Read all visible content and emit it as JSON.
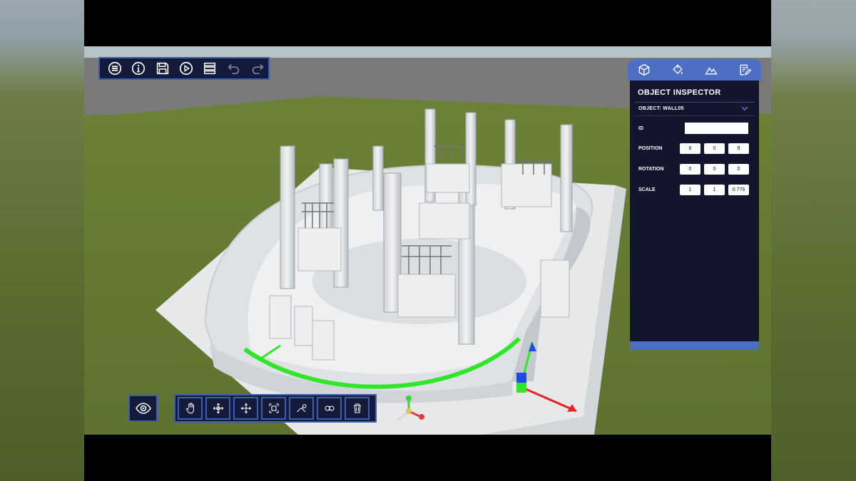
{
  "toolbar": {
    "buttons": [
      {
        "name": "menu-icon"
      },
      {
        "name": "info-icon"
      },
      {
        "name": "save-icon"
      },
      {
        "name": "play-icon"
      },
      {
        "name": "layers-icon"
      },
      {
        "name": "undo-icon"
      },
      {
        "name": "redo-icon"
      }
    ]
  },
  "inspector": {
    "tabs": [
      "cube-icon",
      "paint-bucket-icon",
      "terrain-icon",
      "notes-icon"
    ],
    "title": "OBJECT INSPECTOR",
    "object_label": "OBJECT: WALL05",
    "id_label": "ID",
    "id_value": "",
    "position_label": "POSITION",
    "position": [
      "8",
      "0",
      "9"
    ],
    "rotation_label": "ROTATION",
    "rotation": [
      "0",
      "0",
      "0"
    ],
    "scale_label": "SCALE",
    "scale": [
      "1",
      "1",
      "0.776"
    ]
  },
  "bottom_tools": {
    "view_button": "eye-icon",
    "tools": [
      "select-hand-icon",
      "move-icon",
      "pan-icon",
      "focus-icon",
      "link-icon",
      "mirror-icon",
      "trash-icon"
    ]
  },
  "colors": {
    "panel_bg": "#12152c",
    "accent": "#4c6fc4",
    "grass": "#6c8040",
    "selection_green": "#2fe62a"
  }
}
